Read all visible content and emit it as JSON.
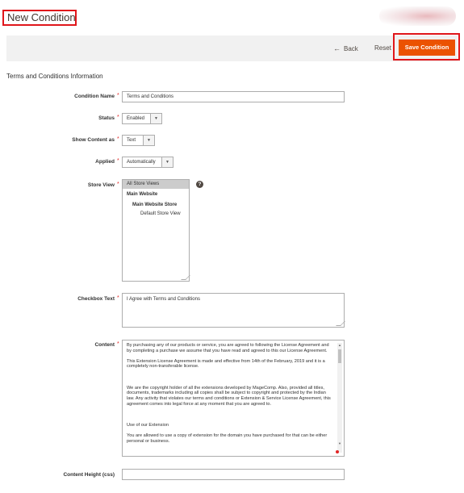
{
  "header": {
    "title": "New Condition"
  },
  "actions": {
    "back_label": "Back",
    "back_arrow": "←",
    "reset_label": "Reset",
    "save_label": "Save Condition"
  },
  "colors": {
    "accent": "#eb5202",
    "highlight_border": "#e0161b",
    "required": "#e22626"
  },
  "form": {
    "section_title": "Terms and Conditions Information",
    "condition_name": {
      "label": "Condition Name",
      "value": "Terms and Conditions"
    },
    "status": {
      "label": "Status",
      "value": "Enabled"
    },
    "show_content_as": {
      "label": "Show Content as",
      "value": "Text"
    },
    "applied": {
      "label": "Applied",
      "value": "Automatically"
    },
    "store_view": {
      "label": "Store View",
      "help": "?",
      "options": [
        {
          "text": "All Store Views",
          "selected": true,
          "level": 0
        },
        {
          "text": "Main Website",
          "level": 0
        },
        {
          "text": "Main Website Store",
          "level": 1
        },
        {
          "text": "Default Store View",
          "level": 2
        }
      ]
    },
    "checkbox_text": {
      "label": "Checkbox Text",
      "value": "I Agree with Terms and Conditions"
    },
    "content": {
      "label": "Content",
      "paragraphs": [
        "By purchasing any of our products or service, you are agreed to following the License Agreement and by completing a purchase we assume that you have read and agreed to this our License Agreement.",
        "This Extension License Agreement is made and effective from 14th of the February, 2019 and it is a completely non-transferable license.",
        "",
        "We are the copyright holder of all the extensions developed by MageComp. Also, provided all titles, documents, trademarks including all copies shall be subject to copyright and protected by the Indian law. Any activity that violates our terms and conditions or Extension & Service License Agreement, this agreement comes into legal force at any moment that you are agreed to.",
        "",
        "Use of our Extension",
        "You are allowed to use a copy of extension for the domain you have purchased for that can be either personal or business."
      ]
    },
    "content_height": {
      "label": "Content Height (css)",
      "value": ""
    },
    "required_mark": "*"
  },
  "icons": {
    "back": "arrow-left-icon",
    "caret": "caret-down-icon",
    "help": "help-icon"
  }
}
